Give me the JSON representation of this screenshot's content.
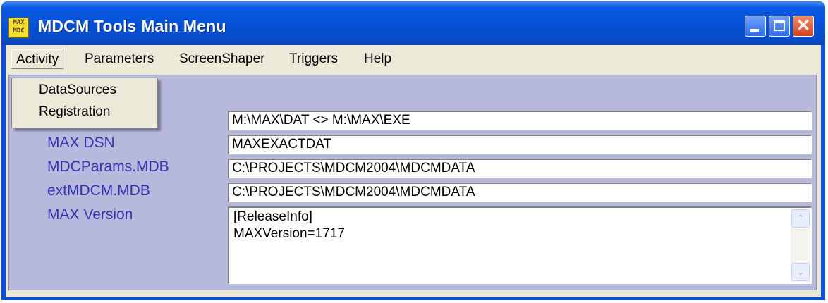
{
  "window": {
    "title": "MDCM Tools Main Menu",
    "icon_text": [
      "MAX",
      "MDC"
    ]
  },
  "menubar": {
    "items": [
      "Activity",
      "Parameters",
      "ScreenShaper",
      "Triggers",
      "Help"
    ]
  },
  "activity_menu": {
    "items": [
      "DataSources",
      "Registration"
    ]
  },
  "fields": {
    "paths": {
      "value": "M:\\MAX\\DAT <> M:\\MAX\\EXE"
    },
    "max_dsn": {
      "label": "MAX DSN",
      "value": "MAXEXACTDAT"
    },
    "mdcparams": {
      "label": "MDCParams.MDB",
      "value": "C:\\PROJECTS\\MDCM2004\\MDCMDATA"
    },
    "extmdcm": {
      "label": "extMDCM.MDB",
      "value": "C:\\PROJECTS\\MDCM2004\\MDCMDATA"
    },
    "max_version": {
      "label": "MAX Version",
      "lines": [
        "[ReleaseInfo]",
        "MAXVersion=1717"
      ]
    }
  },
  "colors": {
    "titlebar": "#0550d6",
    "panel": "#b7b9dc",
    "label": "#3434b0",
    "close_button": "#d4441c"
  },
  "icons": [
    "app-icon",
    "minimize-icon",
    "maximize-icon",
    "close-icon",
    "scroll-up-icon",
    "scroll-down-icon"
  ]
}
